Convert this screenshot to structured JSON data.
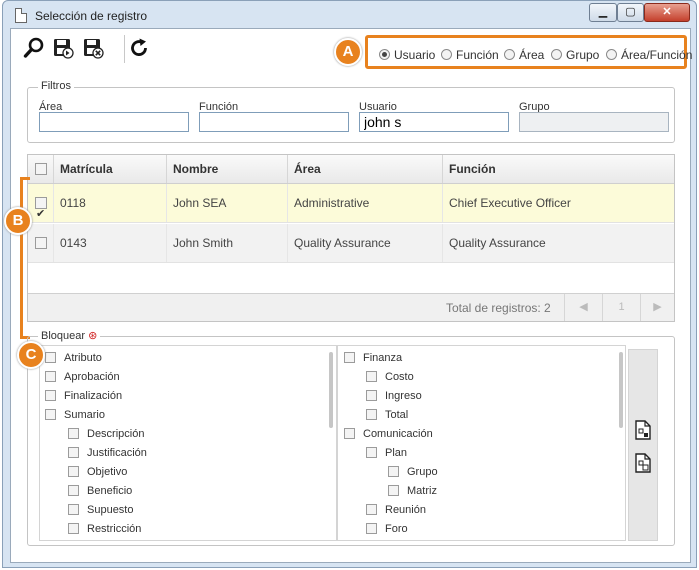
{
  "window": {
    "title": "Selección de registro",
    "min_glyph": "▁",
    "max_glyph": "▢",
    "close_glyph": "✕"
  },
  "toolbar": {
    "icons": [
      "search-icon",
      "save-icon",
      "save-close-icon",
      "refresh-icon"
    ],
    "radios": [
      {
        "label": "Usuario",
        "selected": true
      },
      {
        "label": "Función",
        "selected": false
      },
      {
        "label": "Área",
        "selected": false
      },
      {
        "label": "Grupo",
        "selected": false
      },
      {
        "label": "Área/Función",
        "selected": false
      }
    ]
  },
  "badges": {
    "a": "A",
    "b": "B",
    "c": "C"
  },
  "accent_color": "#e8821e",
  "filters": {
    "legend": "Filtros",
    "area_label": "Área",
    "area_value": "",
    "funcion_label": "Función",
    "funcion_value": "",
    "usuario_label": "Usuario",
    "usuario_value": "john s",
    "grupo_label": "Grupo",
    "grupo_value": ""
  },
  "grid": {
    "columns": [
      "Matrícula",
      "Nombre",
      "Área",
      "Función"
    ],
    "rows": [
      {
        "checked": true,
        "matricula": "0118",
        "nombre": "John SEA",
        "area": "Administrative",
        "funcion": "Chief Executive Officer"
      },
      {
        "checked": false,
        "matricula": "0143",
        "nombre": "John Smith",
        "area": "Quality Assurance",
        "funcion": "Quality Assurance"
      }
    ],
    "total_label": "Total de registros: 2",
    "page_prev": "◀",
    "page_num": "1",
    "page_next": "▶"
  },
  "bloquear": {
    "legend": "Bloquear",
    "required_mark": "⊛",
    "left_items": [
      "Atributo",
      "Aprobación",
      "Finalización",
      "Sumario",
      "Descripción",
      "Justificación",
      "Objetivo",
      "Beneficio",
      "Supuesto",
      "Restricción"
    ],
    "right_items": [
      "Finanza",
      "Costo",
      "Ingreso",
      "Total",
      "Comunicación",
      "Plan",
      "Grupo",
      "Matriz",
      "Reunión",
      "Foro"
    ]
  }
}
